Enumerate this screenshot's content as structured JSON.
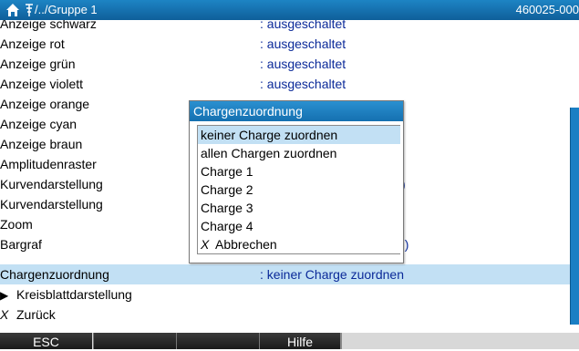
{
  "header": {
    "path": "/../Gruppe 1",
    "device_id": "460025-000"
  },
  "list": {
    "rows": [
      {
        "label": "Anzeige schwarz",
        "value": ": ausgeschaltet"
      },
      {
        "label": "Anzeige rot",
        "value": ": ausgeschaltet"
      },
      {
        "label": "Anzeige grün",
        "value": ": ausgeschaltet"
      },
      {
        "label": "Anzeige violett",
        "value": ": ausgeschaltet"
      },
      {
        "label": "Anzeige orange",
        "value": ""
      },
      {
        "label": "Anzeige cyan",
        "value": ""
      },
      {
        "label": "Anzeige braun",
        "value": ""
      },
      {
        "label": "Amplitudenraster",
        "value": ""
      },
      {
        "label": "Kurvendarstellung",
        "value": ""
      },
      {
        "label": "Kurvendarstellung",
        "value": ""
      },
      {
        "label": "Zoom",
        "value": ""
      },
      {
        "label": "Bargraf",
        "value": ""
      },
      {
        "label": "Chargenzuordnung",
        "value": ": keiner Charge zuordnen"
      },
      {
        "label": "Kreisblattdarstellung",
        "value": ""
      },
      {
        "label": "Zurück",
        "value": ""
      }
    ],
    "clipped_values": {
      "kurvendarstellung_tail": ")",
      "bargraf_tail": "h)"
    }
  },
  "popup": {
    "title": "Chargenzuordnung",
    "options": [
      "keiner Charge zuordnen",
      "allen Chargen zuordnen",
      "Charge 1",
      "Charge 2",
      "Charge 3",
      "Charge 4",
      "Abbrechen"
    ]
  },
  "softkeys": {
    "esc": "ESC",
    "key2": "",
    "key3": "",
    "help": "Hilfe",
    "key5": ""
  },
  "colors": {
    "header": "#1670b0",
    "selection": "#c2e0f4",
    "value_text": "#0b2a99",
    "scrollbar": "#1a7fc4"
  },
  "icons": {
    "home": "home-icon",
    "signal": "antenna-icon",
    "submenu": "triangle-right-icon",
    "cancel": "x-icon"
  }
}
